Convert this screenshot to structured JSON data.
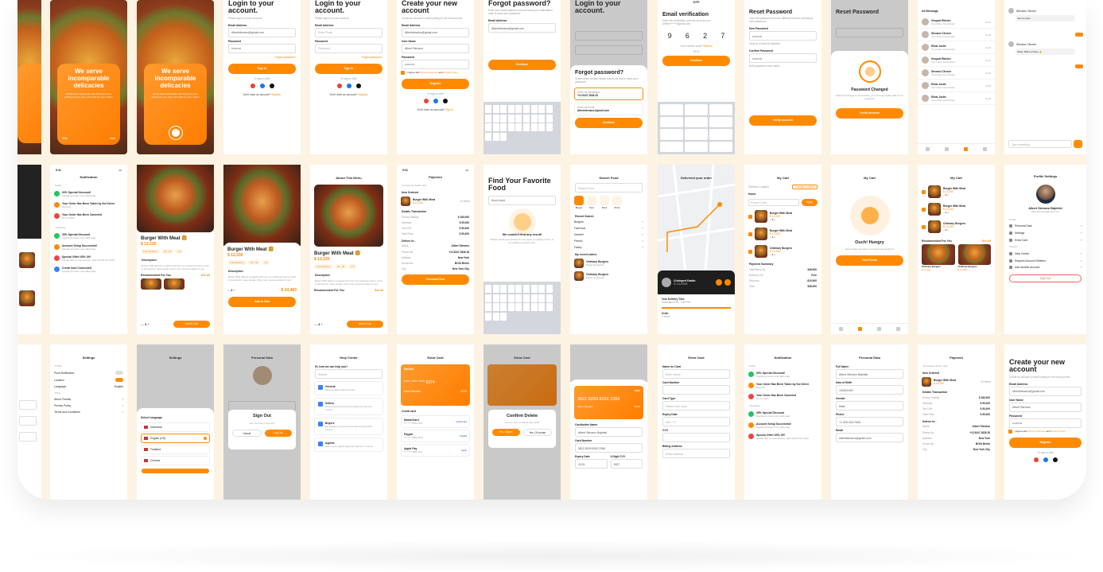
{
  "colors": {
    "accent": "#ff8a00",
    "background": "#fdf3e3"
  },
  "onboarding": {
    "title": "We serve incomparable delicacies",
    "body": "All the best restaurants with their top menu waiting for you, they can't wait for your order!!",
    "skip": "Skip",
    "next": "Next"
  },
  "login": {
    "title": "Login to your account.",
    "subtitle": "Please sign in to your account",
    "email_label": "Email Address",
    "email_value": "Albertstevano@gmail.com",
    "email_ph": "Enter Email",
    "password_label": "Password",
    "password_value": "••••••••••",
    "password_ph": "Password",
    "forgot": "Forgot password?",
    "sign_in": "Sign In",
    "or": "Or sign in with",
    "no_account": "Don't have an account?",
    "register": "Register"
  },
  "register": {
    "title": "Create your new account",
    "subtitle": "Create an account to start looking for the food you like",
    "email_label": "Email Address",
    "email_value": "Albertstevano@gmail.com",
    "user_label": "User Name",
    "user_value": "Albert Stevano",
    "password_label": "Password",
    "password_value": "••••••••••",
    "terms_pre": "I Agree with",
    "terms": "Terms of Service",
    "and": "and",
    "privacy": "Privacy Policy",
    "button": "Register",
    "or": "Or sign in with",
    "have_account": "Don't have an account?",
    "sign_in": "Sign In"
  },
  "forgot": {
    "title": "Forgot password?",
    "subtitle": "Enter your email address and we'll send you confirmation code to reset your password",
    "email_label": "Email Address",
    "email_value": "Albertstevano@gmail.com",
    "button": "Continue",
    "sheet_title": "Forgot password?",
    "sheet_sub": "Select which contact details should we use to reset your password",
    "opt1_label": "Send via WhatsApp",
    "opt1_value": "+12 8347 2838 28",
    "opt2_label": "Send via Email",
    "opt2_value": "Albertstevano@gmail.com",
    "continue": "Continue"
  },
  "verify": {
    "status": "OTP",
    "title": "Email verification",
    "subtitle": "Enter the verification code we send you on: Alberts******@gmail.com",
    "digits": [
      "9",
      "6",
      "2",
      "7"
    ],
    "resend": "Don't receive code?",
    "resend_link": "Resend",
    "timer": "09:00",
    "button": "Continue"
  },
  "reset": {
    "title": "Reset Password",
    "subtitle": "Your new password must be different from the previously used password",
    "new_label": "New Password",
    "new_value": "••••••••••",
    "hint1": "Must be at least 8 character",
    "confirm_label": "Confirm Password",
    "confirm_value": "••••••••••",
    "hint2": "Both password must match",
    "button": "Verify Account",
    "changed_title": "Password Changed",
    "changed_sub": "Password changed successfully, you can login again with a new password",
    "changed_button": "Verify Account"
  },
  "messages": {
    "title": "All Message",
    "items": [
      {
        "name": "Geopart Etdsien",
        "msg": "Your Order Just Arrived!",
        "time": "13.47",
        "badge": "1"
      },
      {
        "name": "Stevano Clirover",
        "msg": "Your Order Just Arrived!",
        "time": "11.23",
        "badge": "1"
      },
      {
        "name": "Elisia Justin",
        "msg": "Your Order Just Arrived!",
        "time": "11.23",
        "badge": ""
      },
      {
        "name": "Geopart Etdsien",
        "msg": "Your Order Just Arrived!",
        "time": "13.47",
        "badge": "1"
      },
      {
        "name": "Stevano Clirover",
        "msg": "Your Order Just Arrived!",
        "time": "11.23",
        "badge": "1"
      },
      {
        "name": "Elisia Justin",
        "msg": "Your Order Just Arrived!",
        "time": "11.23",
        "badge": ""
      },
      {
        "name": "Elisia Justin",
        "msg": "Your Order Just Arrived!",
        "time": "11.23",
        "badge": ""
      }
    ]
  },
  "chat": {
    "name1": "Stevano Clirover",
    "msg1": "Just to order",
    "name2": "Stevano Clirover",
    "msg2": "Okay, Wait a minute 👍",
    "input_ph": "Type something..."
  },
  "notification": {
    "title": "Notification",
    "today": "Today",
    "yesterday": "Yesterday",
    "items_today": [
      {
        "t": "30% Special Discount!",
        "s": "Special promotion only valid today"
      },
      {
        "t": "Your Order Has Been Taken by the Driver",
        "s": "Recently"
      },
      {
        "t": "Your Order Has Been Canceled",
        "s": "19 Jun 2023"
      }
    ],
    "items_yesterday": [
      {
        "t": "35% Special Discount",
        "s": "Special promotion only valid today"
      },
      {
        "t": "Account Setup Successful!",
        "s": "Special promotion only valid today"
      },
      {
        "t": "Special Offer! 60% Off",
        "s": "Special offer for new account, valid until 20 Nov 2022"
      },
      {
        "t": "Credit Card Connected",
        "s": "Special promotion only valid today"
      }
    ]
  },
  "detail": {
    "header": "About This Menu",
    "name": "Burger With Meat 🍔",
    "price": "$ 12,230",
    "free": "Free Delivery",
    "time": "20 - 30",
    "rating": "4.5",
    "desc_title": "Description",
    "desc": "Burger With Meat is a typical food from our restaurant that is much in demand by many people, this is very recommended for you.",
    "rec": "Recommended For You",
    "see_all": "See All",
    "qty": "4",
    "add": "Add to Cart",
    "total": "$ 24,460",
    "total2": "$ 24,460"
  },
  "payment": {
    "title": "Payment",
    "recent": "You deserve better meal",
    "item_ordered": "Item Ordered",
    "item": "Burger With Meat",
    "item_price": "$ 12,230",
    "item_qty": "14 items",
    "details": "Details Transaction",
    "rows": [
      [
        "Cherry Healthy",
        "$ 180,000"
      ],
      [
        "Ordinary",
        "$ 50,000"
      ],
      [
        "Tax 10%",
        "$ 50,000"
      ],
      [
        "Total Price",
        "$ 50,000"
      ]
    ],
    "deliver": "Deliver to :",
    "addr": [
      [
        "Name",
        "Albert Stevano"
      ],
      [
        "Phone No.",
        "+12 8347 2838 28"
      ],
      [
        "Address",
        "New York"
      ],
      [
        "House No.",
        "BC54 Berlin"
      ],
      [
        "City",
        "New York City"
      ]
    ],
    "button": "Checkout Now"
  },
  "find": {
    "title": "Find Your Favorite Food",
    "query": "Avorr boyd",
    "empty_title": "We couldn't find any result!",
    "empty_sub": "Please check your search for any typos or spelling errors, or try a different search term.",
    "search_title": "Search Food",
    "search_ph": "Search Food",
    "chips": [
      "Burger",
      "Taco",
      "Drink",
      "Pizza"
    ],
    "recent": "Recent Search",
    "recents": [
      "Burgers",
      "Fast food",
      "Dessert",
      "French",
      "Fastry"
    ],
    "my_orders": "My recent orders",
    "orders": [
      {
        "n": "Ordinary Burgers",
        "p": "Burger Restaurant",
        "r": "4.9",
        "d": "190m"
      },
      {
        "n": "Ordinary Burgers",
        "p": "Burger Restaurant",
        "r": "4.9",
        "d": "190m"
      }
    ]
  },
  "map": {
    "title": "Delivered your order",
    "driver": "Cristopert Dastin",
    "driver_sub": "ID 2445556",
    "eta_label": "Your Delivery Time",
    "eta": "Estimated 8:30 - 9:15 PM",
    "order": "Order",
    "order_time": "2:30pm",
    "bottom": "2:30 pm"
  },
  "cart": {
    "title": "My Cart",
    "loc_label": "Delivery Location",
    "loc": "Home",
    "change": "Change Location",
    "promo_ph": "Promo Code...",
    "apply": "Apply",
    "items": [
      {
        "n": "Burger With Meat",
        "p": "$ 12,230",
        "q": "1"
      },
      {
        "n": "Burger With Meat",
        "p": "$ 12,230",
        "q": "1"
      },
      {
        "n": "Ordinary Burgers",
        "p": "$ 12,230",
        "q": "1"
      }
    ],
    "summary": "Payment Summary",
    "sum_rows": [
      [
        "Total Items (3)",
        "$48,900"
      ],
      [
        "Delivery Fee",
        "Free"
      ],
      [
        "Discount",
        "-$10,900"
      ],
      [
        "Total",
        "$38,000"
      ]
    ],
    "hungry_title": "Ouch! Hungry",
    "hungry_sub": "Seems like you have not ordered any food yet",
    "find_button": "Find Foods",
    "rec": "Recommended For You",
    "see_all": "See All",
    "rec_items": [
      {
        "n": "Ordinary Burgers",
        "r": "4.9",
        "d": "190m",
        "p": "$ 17,230"
      },
      {
        "n": "Ordinary Burgers",
        "r": "4.9",
        "d": "190m",
        "p": "$ 17,230"
      }
    ]
  },
  "profile": {
    "title": "Profile Settings",
    "name": "Albert Stevano Bajefski",
    "email": "Albertstevano@gmail.com",
    "profile": "Profile",
    "items": [
      "Personal Data",
      "Settings",
      "Extra Card"
    ],
    "support": "Support",
    "support_items": [
      "Help Center",
      "Request Account Deletion",
      "Add another account"
    ],
    "signout": "Sign Out"
  },
  "settings": {
    "title": "Settings",
    "profile": "Profile",
    "push": "Push Notification",
    "location": "Location",
    "language": "Language",
    "lang_value": "English",
    "other": "Other",
    "about": "About Ticketis",
    "privacy": "Privacy Policy",
    "terms": "Terms and Conditions",
    "select_lang": "Select Language",
    "langs": [
      "Indonesia",
      "English (US)",
      "Thailand",
      "Chinese"
    ]
  },
  "signout": {
    "screen_title": "Personal Data",
    "title": "Sign Out",
    "text": "Are you sure to log out?",
    "cancel": "Cancel",
    "confirm": "Log Out"
  },
  "help": {
    "title": "Help Center",
    "greeting": "Hi, how we can help you?",
    "search_ph": "Search",
    "items": [
      {
        "t": "General",
        "s": "Basic questions about Yummy"
      },
      {
        "t": "Sellers",
        "s": "All you need to know about selling your items to Yummy"
      },
      {
        "t": "Buyers",
        "s": "Everything you need to know about buying with Yummy"
      },
      {
        "t": "Agents",
        "s": "How to post, agents agencies agents on Yummy"
      }
    ]
  },
  "extra": {
    "title": "Extra Card",
    "card_brand": "SmCard",
    "card_no": "**** **** **** 8374",
    "card_name": "Albert Stevano",
    "card_exp": "02/30",
    "credit": "Credit card",
    "cards": [
      {
        "n": "MasterCard",
        "no": "**** **** 0783 7873",
        "brand": "mastercard"
      },
      {
        "n": "Paypal",
        "no": "**** **** 0582 4672",
        "brand": "PayPal"
      },
      {
        "n": "Apple Pay",
        "no": "**** **** 0582 4672",
        "brand": "Apple"
      }
    ],
    "confirm_title": "Confirm Delete",
    "confirm_text": "Are you sure to delete this card?",
    "yes": "Yes, I Agree",
    "no": "Yes, Of course",
    "visa_no": "3822 8293 8292 2356",
    "visa_name": "Albert Stevano",
    "visa_exp": "02/30",
    "holder": "Cardholder Name",
    "holder_value": "Albert Stevano Bajefski",
    "number": "Card Number",
    "number_value": "3822 8293 8292 2356",
    "exp": "Expiry Date",
    "exp_value": "11/24",
    "cvv": "3-Digit CVV",
    "cvv_value": "2837"
  },
  "addcard": {
    "title": "Extra Card",
    "name_label": "Name on Card",
    "name_ph": "Enter Name",
    "number_label": "Card Number",
    "type_label": "Card Type",
    "type_ph": "Select Card Type",
    "exp_label": "Expiry Date",
    "exp_ph": "MM / YY",
    "cvv_label": "CVV",
    "billing": "Billing Address",
    "addr_ph": "Enter Address"
  },
  "notif2": {
    "title": "Notification"
  },
  "personal": {
    "title": "Personal Data",
    "full": "Full Name",
    "full_value": "Albert Stevano Bajefski",
    "dob": "Date of Birth",
    "dob_value": "19/06/1999",
    "gender": "Gender",
    "gender_value": "Male",
    "phone": "Phone",
    "phone_value": "+1 325-433-7656",
    "email": "Email",
    "email_value": "albertstevano@gmail.com"
  },
  "payment2": {
    "title": "Payment"
  },
  "register2": {
    "title": "Create your new account",
    "subtitle": "Create an account to start looking for the food you like",
    "email_label": "Email Address",
    "email_value": "Albertstevano@gmail.com",
    "user_label": "User Name",
    "user_value": "Albert Stevano",
    "password_label": "Password",
    "password_value": "••••••••••",
    "button": "Register",
    "or": "Or sign in with"
  },
  "misc": {
    "time": "9:41"
  }
}
